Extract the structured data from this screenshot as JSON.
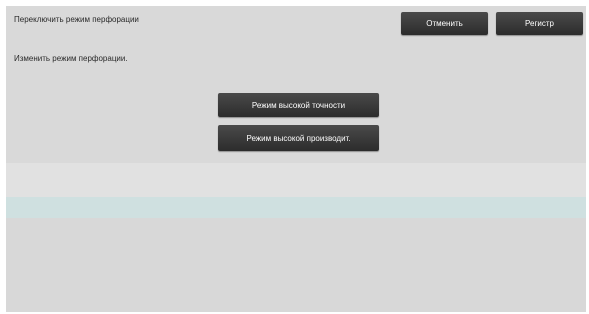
{
  "header": {
    "title": "Переключить режим перфорации",
    "cancel_label": "Отменить",
    "register_label": "Регистр"
  },
  "main": {
    "description": "Изменить режим перфорации.",
    "modes": [
      {
        "label": "Режим высокой точности"
      },
      {
        "label": "Режим высокой производит."
      }
    ]
  },
  "colors": {
    "button": "#333333",
    "background": "#dcdcdc",
    "accent_band": "#cfe0e0"
  }
}
